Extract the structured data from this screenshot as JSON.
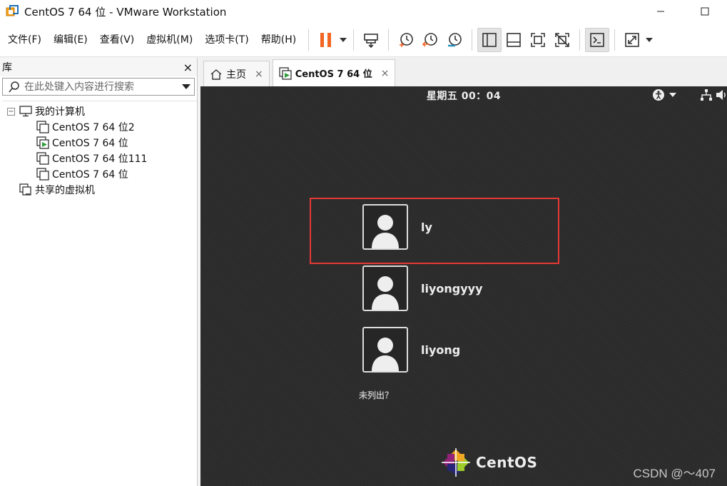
{
  "window": {
    "title": "CentOS 7 64 位 - VMware Workstation"
  },
  "menu": [
    "文件(F)",
    "编辑(E)",
    "查看(V)",
    "虚拟机(M)",
    "选项卡(T)",
    "帮助(H)"
  ],
  "toolbar": {
    "icons": [
      "pause-icon",
      "send-ctrl-alt-del-icon",
      "snapshot-icon",
      "revert-snapshot-icon",
      "snapshot-manager-icon",
      "show-library-icon",
      "thumbnail-bar-icon",
      "full-screen-icon",
      "unity-icon",
      "console-view-icon",
      "stretch-guest-icon"
    ]
  },
  "library": {
    "title": "库",
    "close": "×",
    "search_placeholder": "在此处键入内容进行搜索",
    "root": "我的计算机",
    "vms": [
      "CentOS 7 64 位2",
      "CentOS 7 64 位",
      "CentOS 7 64 位111",
      "CentOS 7 64 位"
    ],
    "shared": "共享的虚拟机"
  },
  "tabs": [
    {
      "label": "主页",
      "close": "×"
    },
    {
      "label": "CentOS 7 64 位",
      "close": "×"
    }
  ],
  "guest": {
    "clock": "星期五 00：04",
    "users": [
      "ly",
      "liyongyyy",
      "liyong"
    ],
    "not_listed": "未列出？",
    "brand": "CentOS"
  },
  "watermark": "CSDN @～407",
  "colors": {
    "highlight": "#e53935",
    "pause": "#f26522",
    "screen_bg": "#2c2c2c"
  }
}
